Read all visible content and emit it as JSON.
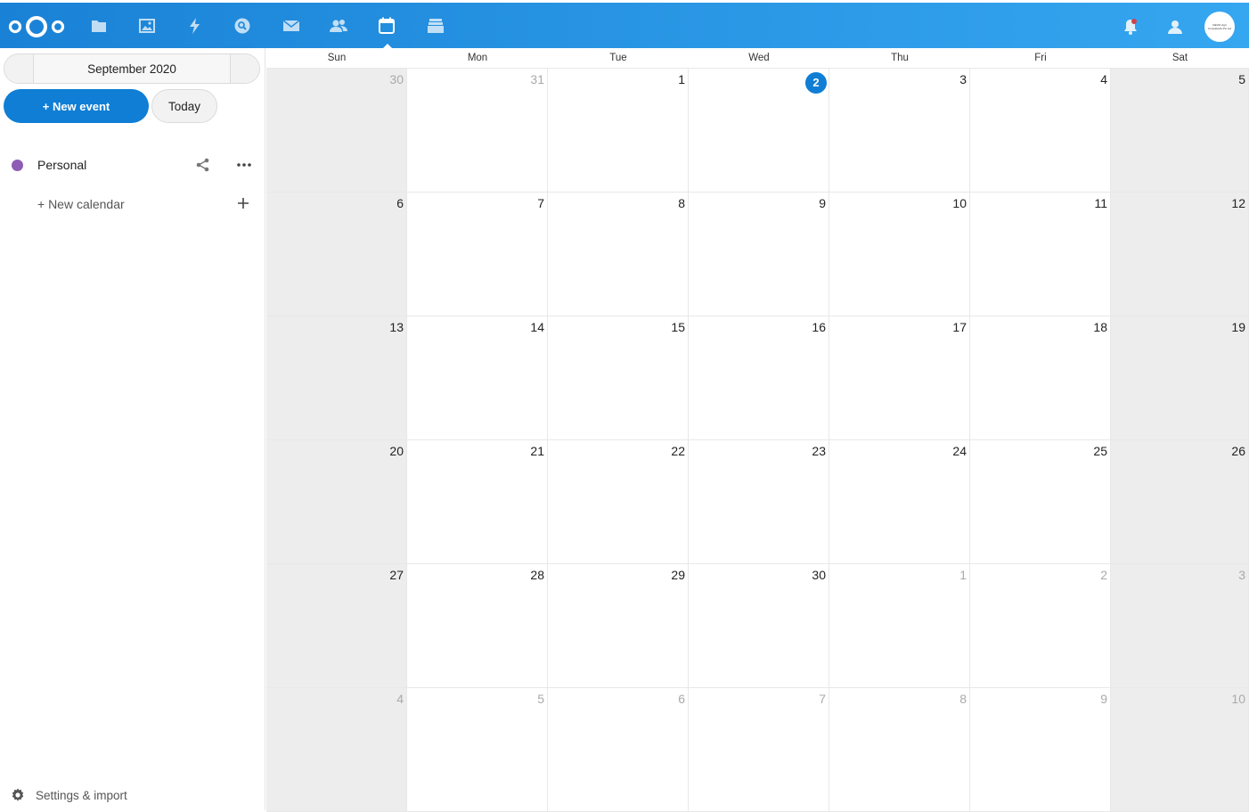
{
  "header": {
    "apps": [
      {
        "name": "files-icon"
      },
      {
        "name": "photos-icon"
      },
      {
        "name": "activity-icon"
      },
      {
        "name": "search-icon"
      },
      {
        "name": "mail-icon"
      },
      {
        "name": "contacts-icon"
      },
      {
        "name": "calendar-icon",
        "active": true
      },
      {
        "name": "deck-icon"
      }
    ],
    "avatar_text": "DEVIC Agri Consultants Pvt Ltd"
  },
  "sidebar": {
    "month_label": "September 2020",
    "new_event_label": "+ New event",
    "today_label": "Today",
    "calendars": [
      {
        "name": "Personal",
        "color": "#8e5bb5"
      }
    ],
    "new_calendar_label": "+ New calendar",
    "settings_label": "Settings & import"
  },
  "calendar": {
    "weekdays": [
      "Sun",
      "Mon",
      "Tue",
      "Wed",
      "Thu",
      "Fri",
      "Sat"
    ],
    "weeks": [
      [
        {
          "d": "30",
          "o": true
        },
        {
          "d": "31",
          "o": true
        },
        {
          "d": "1"
        },
        {
          "d": "2",
          "today": true
        },
        {
          "d": "3"
        },
        {
          "d": "4"
        },
        {
          "d": "5"
        }
      ],
      [
        {
          "d": "6"
        },
        {
          "d": "7"
        },
        {
          "d": "8"
        },
        {
          "d": "9"
        },
        {
          "d": "10"
        },
        {
          "d": "11"
        },
        {
          "d": "12"
        }
      ],
      [
        {
          "d": "13"
        },
        {
          "d": "14"
        },
        {
          "d": "15"
        },
        {
          "d": "16"
        },
        {
          "d": "17"
        },
        {
          "d": "18"
        },
        {
          "d": "19"
        }
      ],
      [
        {
          "d": "20"
        },
        {
          "d": "21"
        },
        {
          "d": "22"
        },
        {
          "d": "23"
        },
        {
          "d": "24"
        },
        {
          "d": "25"
        },
        {
          "d": "26"
        }
      ],
      [
        {
          "d": "27"
        },
        {
          "d": "28"
        },
        {
          "d": "29"
        },
        {
          "d": "30"
        },
        {
          "d": "1",
          "o": true
        },
        {
          "d": "2",
          "o": true
        },
        {
          "d": "3",
          "o": true
        }
      ],
      [
        {
          "d": "4",
          "o": true
        },
        {
          "d": "5",
          "o": true
        },
        {
          "d": "6",
          "o": true
        },
        {
          "d": "7",
          "o": true
        },
        {
          "d": "8",
          "o": true
        },
        {
          "d": "9",
          "o": true
        },
        {
          "d": "10",
          "o": true
        }
      ]
    ]
  },
  "colors": {
    "header_start": "#1a82d6",
    "header_end": "#35a6f0",
    "primary": "#0f7ed4",
    "weekend_bg": "#ededed"
  }
}
